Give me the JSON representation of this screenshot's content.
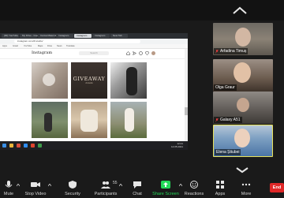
{
  "browser": {
    "tabs": [
      "(90) YouTube",
      "My Drive - Google",
      "Canva Maternity",
      "Instagram",
      "Instagram",
      "Instagram",
      "New Tab"
    ],
    "url": "instagram.com/dl.studio/",
    "bookmarks": [
      "Apps",
      "Gmail",
      "YouTube",
      "Maps",
      "Drive",
      "News",
      "Translate"
    ]
  },
  "instagram": {
    "logo": "Instagram",
    "search_placeholder": "Search",
    "giveaway_title": "GIVEAWAY",
    "giveaway_sub": "dl.studio"
  },
  "taskbar": {
    "time": "12:21",
    "date": "14.05.2021"
  },
  "participants": [
    {
      "name": "Arfadina Timuș"
    },
    {
      "name": "Olga Graur"
    },
    {
      "name": "Galaxy A51"
    },
    {
      "name": "Elena Știubei"
    }
  ],
  "toolbar": {
    "mute": "Mute",
    "stop_video": "Stop Video",
    "security": "Security",
    "participants": "Participants",
    "participants_count": "55",
    "chat": "Chat",
    "share_screen": "Share Screen",
    "reactions": "Reactions",
    "apps": "Apps",
    "more": "More",
    "end": "End"
  },
  "colors": {
    "share_green": "#23d959",
    "end_red": "#e02828",
    "active_speaker": "#e8e25c"
  }
}
